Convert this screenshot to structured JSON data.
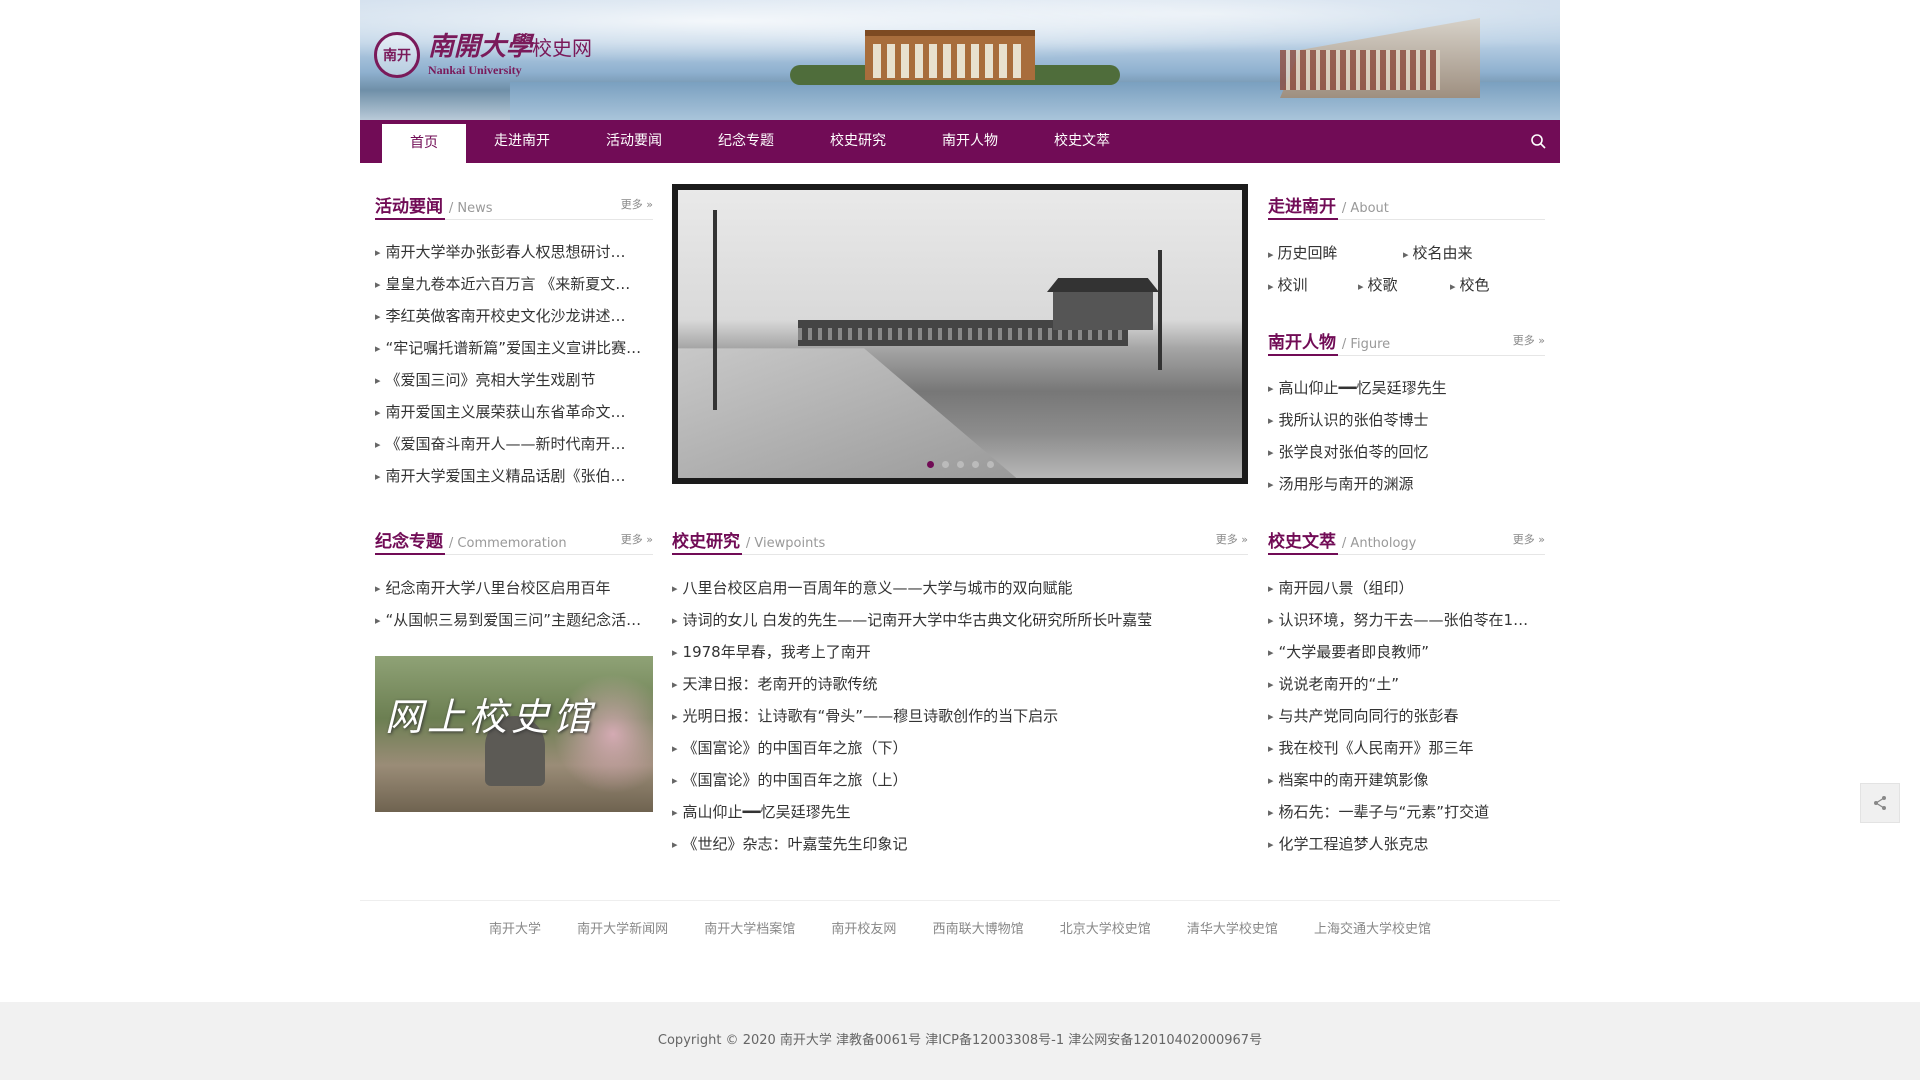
{
  "header": {
    "seal_text": "南开",
    "site_name_cn": "南開大學",
    "site_name_sub": "校史网",
    "site_name_en": "Nankai University"
  },
  "nav": {
    "items": [
      "首页",
      "走进南开",
      "活动要闻",
      "纪念专题",
      "校史研究",
      "南开人物",
      "校史文萃"
    ],
    "active_index": 0
  },
  "news": {
    "title": "活动要闻",
    "title_en": "/ News",
    "more": "更多 »",
    "items": [
      "南开大学举办张彭春人权思想研讨…",
      "皇皇九卷本近六百万言 《来新夏文…",
      "李红英做客南开校史文化沙龙讲述…",
      "“牢记嘱托谱新篇”爱国主义宣讲比赛…",
      "《爱国三问》亮相大学生戏剧节",
      "南开爱国主义展荣获山东省革命文…",
      "《爱国奋斗南开人——新时代南开…",
      "南开大学爱国主义精品话剧《张伯…"
    ]
  },
  "slider": {
    "dots": 5,
    "active_dot": 0
  },
  "about": {
    "title": "走进南开",
    "title_en": "/ About",
    "links": [
      "历史回眸",
      "校名由来",
      "校训",
      "校歌",
      "校色"
    ]
  },
  "figure": {
    "title": "南开人物",
    "title_en": "/ Figure",
    "more": "更多 »",
    "items": [
      "高山仰止━━忆吴廷璆先生",
      "我所认识的张伯苓博士",
      "张学良对张伯苓的回忆",
      "汤用彤与南开的渊源"
    ]
  },
  "commemoration": {
    "title": "纪念专题",
    "title_en": "/ Commemoration",
    "more": "更多 »",
    "items": [
      "纪念南开大学八里台校区启用百年",
      "“从国帜三易到爱国三问”主题纪念活…"
    ],
    "museum_label": "网上校史馆"
  },
  "viewpoints": {
    "title": "校史研究",
    "title_en": "/ Viewpoints",
    "more": "更多 »",
    "items": [
      "八里台校区启用一百周年的意义——大学与城市的双向赋能",
      "诗词的女儿 白发的先生——记南开大学中华古典文化研究所所长叶嘉莹",
      "1978年早春，我考上了南开",
      "天津日报：老南开的诗歌传统",
      "光明日报：让诗歌有“骨头”——穆旦诗歌创作的当下启示",
      "《国富论》的中国百年之旅（下）",
      "《国富论》的中国百年之旅（上）",
      "高山仰止━━忆吴廷璆先生",
      "《世纪》杂志：叶嘉莹先生印象记"
    ]
  },
  "anthology": {
    "title": "校史文萃",
    "title_en": "/ Anthology",
    "more": "更多 »",
    "items": [
      "南开园八景（组印）",
      "认识环境，努力干去——张伯苓在1…",
      "“大学最要者即良教师”",
      "说说老南开的“土”",
      "与共产党同向同行的张彭春",
      "我在校刊《人民南开》那三年",
      "档案中的南开建筑影像",
      "杨石先：一辈子与“元素”打交道",
      "化学工程追梦人张克忠"
    ]
  },
  "friend_links": [
    "南开大学",
    "南开大学新闻网",
    "南开大学档案馆",
    "南开校友网",
    "西南联大博物馆",
    "北京大学校史馆",
    "清华大学校史馆",
    "上海交通大学校史馆"
  ],
  "footer": {
    "copyright": "Copyright © 2020 南开大学 津教备0061号   津ICP备12003308号-1   津公网安备12010402000967号"
  },
  "colors": {
    "brand": "#710c56",
    "text": "#333333"
  }
}
